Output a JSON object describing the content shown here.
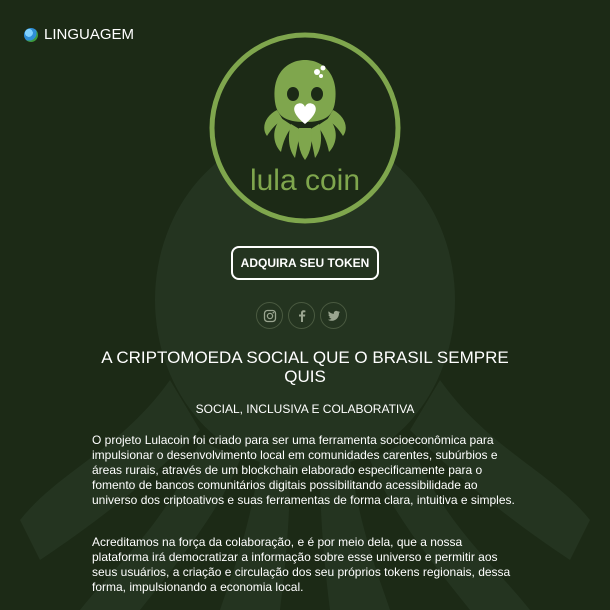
{
  "language": {
    "label": "LINGUAGEM",
    "icon": "globe-icon"
  },
  "logo": {
    "text": "lula coin",
    "icon": "squid-logo-icon"
  },
  "cta": {
    "label": "ADQUIRA SEU TOKEN"
  },
  "social": [
    {
      "name": "instagram-icon",
      "glyph": ""
    },
    {
      "name": "facebook-icon",
      "glyph": "f"
    },
    {
      "name": "twitter-icon",
      "glyph": ""
    }
  ],
  "headline": "A CRIPTOMOEDA SOCIAL QUE O BRASIL SEMPRE QUIS",
  "subheadline": "SOCIAL, INCLUSIVA E COLABORATIVA",
  "paragraphs": [
    "O projeto Lulacoin foi criado para ser uma ferramenta socioeconômica para impulsionar o desenvolvimento local em comunidades carentes, subúrbios e áreas rurais, através de um blockchain elaborado especificamente para o fomento de bancos comunitários digitais possibilitando acessibilidade ao universo dos criptoativos e suas ferramentas de forma clara, intuitiva e simples.",
    "Acreditamos na força da colaboração, e é por meio dela, que a nossa plataforma irá democratizar a informação sobre esse universo e permitir aos seus usuários, a criação e circulação dos seu próprios tokens regionais, dessa forma, impulsionando a economia local."
  ],
  "colors": {
    "background": "#1c2a16",
    "accent": "#7fa64d",
    "text": "#ffffff"
  }
}
